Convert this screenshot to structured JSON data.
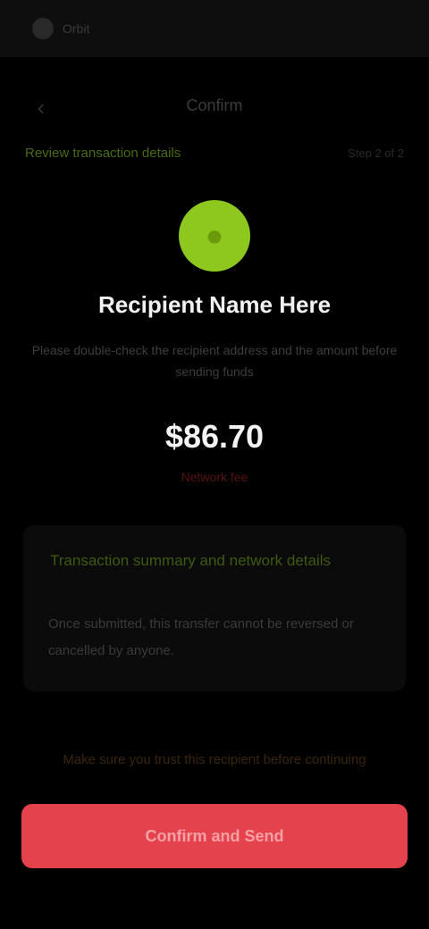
{
  "status_bar": {
    "app_icon": "app-logo-icon",
    "label": "Orbit"
  },
  "header": {
    "back_icon": "chevron-left-icon",
    "title": "Confirm"
  },
  "subheader": {
    "link_text": "Review transaction details",
    "meta_text": "Step 2 of 2"
  },
  "recipient": {
    "avatar_icon": "user-icon",
    "avatar_color": "#8ec81e",
    "name": "Recipient Name Here",
    "description": "Please double-check the recipient address and the amount before sending funds"
  },
  "transfer": {
    "amount": "$86.70",
    "amount_sub": "Network fee"
  },
  "info_card": {
    "title": "Transaction summary and network details",
    "body": "Once submitted, this transfer cannot be reversed or cancelled by anyone."
  },
  "warning": {
    "text": "Make sure you trust this recipient before continuing"
  },
  "actions": {
    "primary_label": "Confirm and Send",
    "primary_color": "#e4424c"
  }
}
